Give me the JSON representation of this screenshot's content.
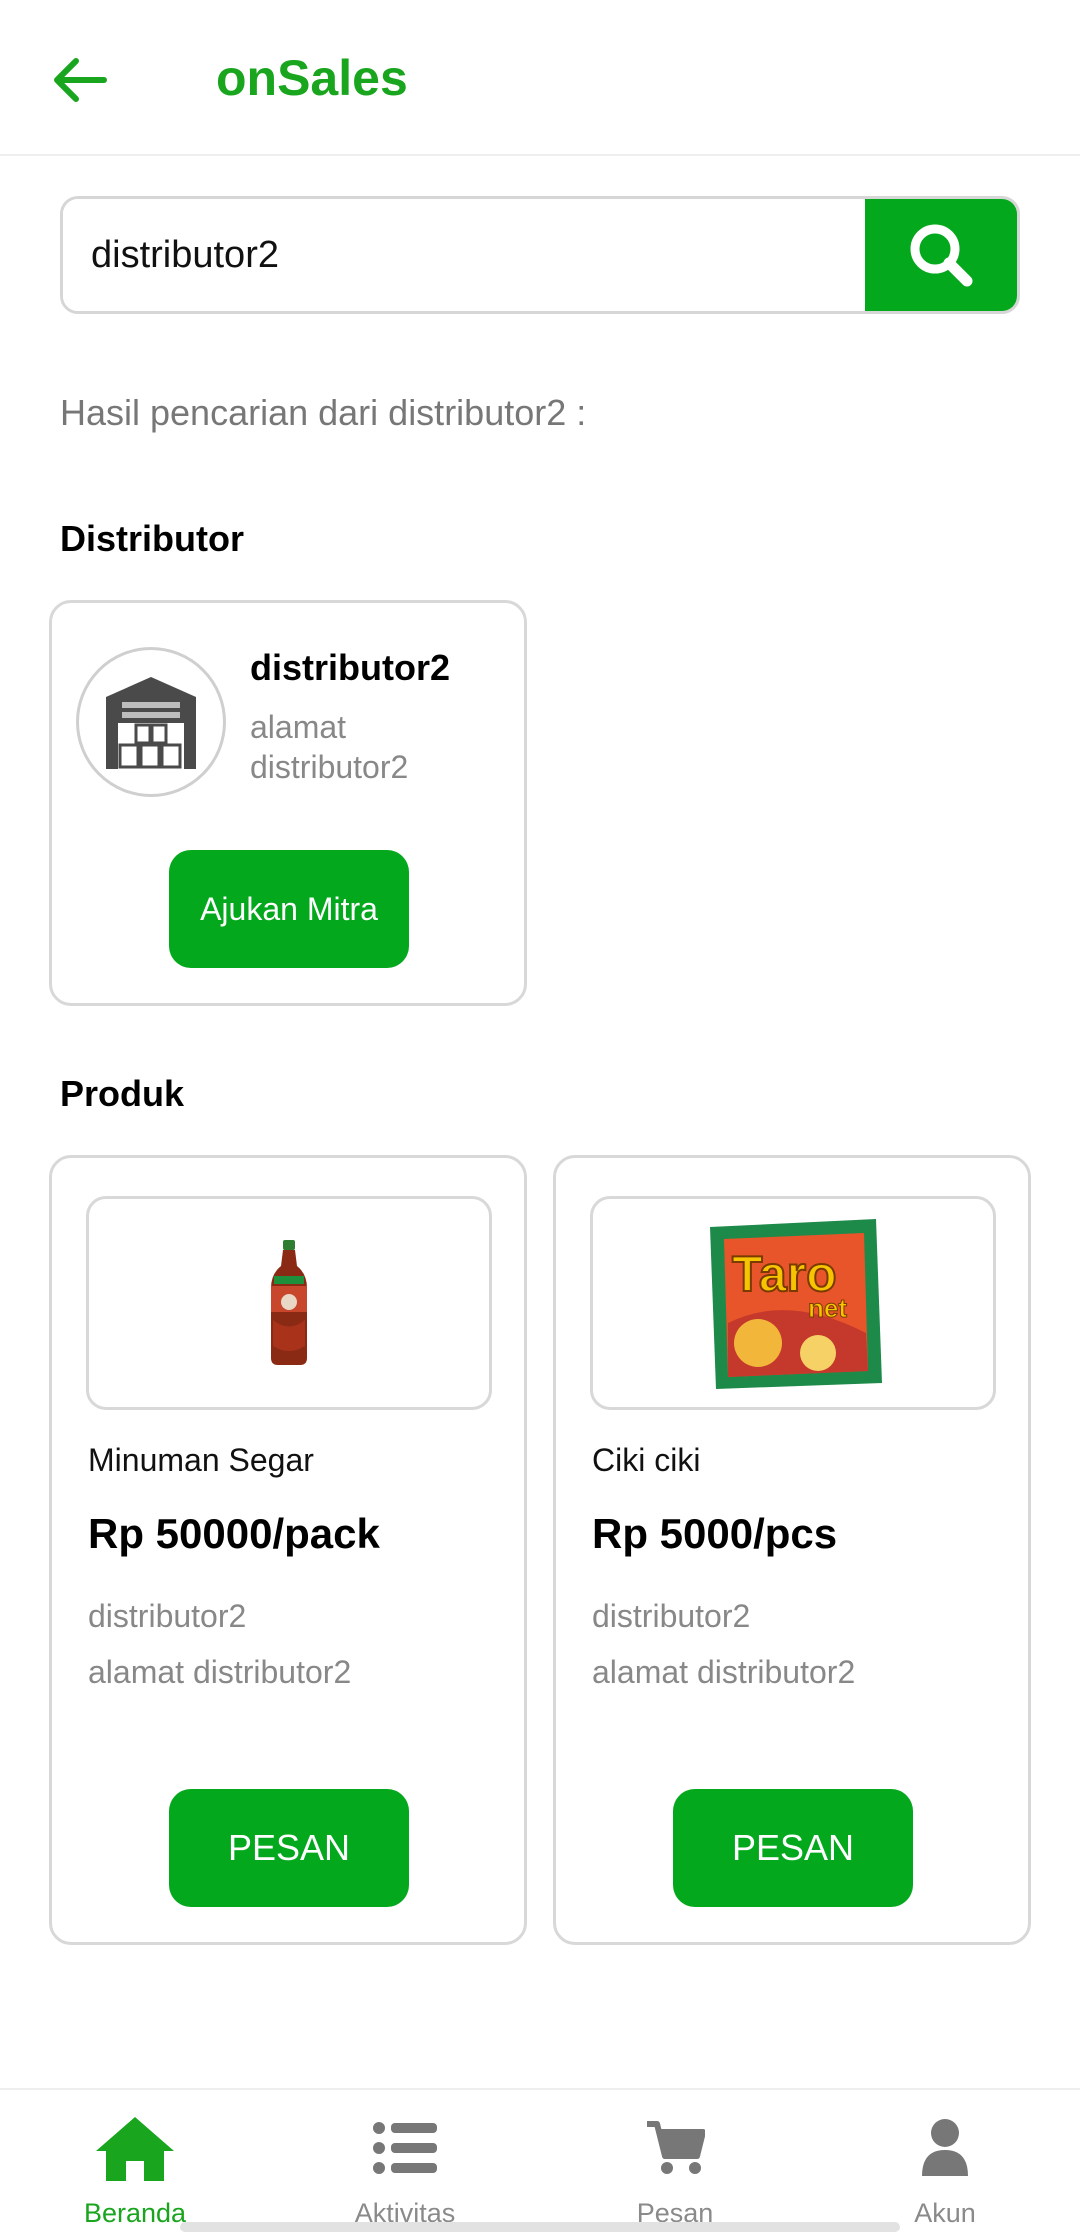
{
  "app": {
    "title": "onSales",
    "accent_color": "#04a81d"
  },
  "search": {
    "value": "distributor2",
    "placeholder": ""
  },
  "result_caption": "Hasil pencarian dari distributor2 :",
  "distributor_section": {
    "title": "Distributor",
    "card": {
      "name": "distributor2",
      "address": "alamat distributor2",
      "button_label": "Ajukan Mitra",
      "icon": "warehouse-icon"
    }
  },
  "product_section": {
    "title": "Produk",
    "items": [
      {
        "name": "Minuman Segar",
        "price": "Rp 50000/pack",
        "distributor": "distributor2",
        "address": "alamat distributor2",
        "button_label": "PESAN",
        "image": "tea-bottle-image"
      },
      {
        "name": "Ciki ciki",
        "price": "Rp 5000/pcs",
        "distributor": "distributor2",
        "address": "alamat distributor2",
        "button_label": "PESAN",
        "image": "taro-net-snack-image",
        "image_text": [
          "Taro",
          "net"
        ]
      }
    ]
  },
  "bottom_nav": {
    "items": [
      {
        "label": "Beranda",
        "icon": "home-icon",
        "active": true
      },
      {
        "label": "Aktivitas",
        "icon": "list-icon",
        "active": false
      },
      {
        "label": "Pesan",
        "icon": "cart-icon",
        "active": false
      },
      {
        "label": "Akun",
        "icon": "user-icon",
        "active": false
      }
    ]
  }
}
